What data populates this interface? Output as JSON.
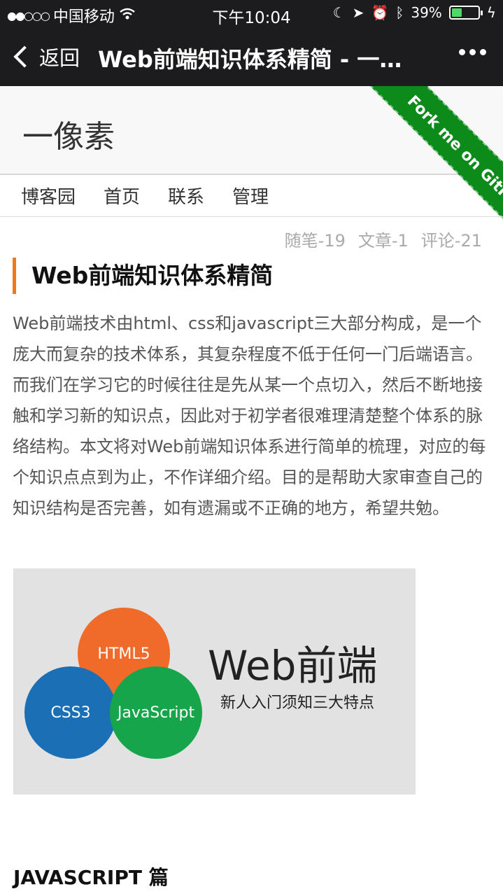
{
  "status_bar": {
    "signal_dots": "●●○○○",
    "carrier": "中国移动",
    "time": "下午10:04",
    "battery_percent": "39%",
    "battery_level": 0.39,
    "icons": [
      "wifi-icon",
      "moon-icon",
      "location-arrow-icon",
      "alarm-icon",
      "bluetooth-icon",
      "battery-icon",
      "charging-icon"
    ]
  },
  "nav": {
    "back_label": "返回",
    "title": "Web前端知识体系精简 - 一…"
  },
  "site": {
    "name": "一像素",
    "nav_items": [
      "博客园",
      "首页",
      "联系",
      "管理"
    ],
    "stats": [
      "随笔-19",
      "文章-1",
      "评论-21"
    ],
    "ribbon_text": "Fork me on GitHub"
  },
  "article": {
    "title": "Web前端知识体系精简",
    "body": "Web前端技术由html、css和javascript三大部分构成，是一个庞大而复杂的技术体系，其复杂程度不低于任何一门后端语言。而我们在学习它的时候往往是先从某一个点切入，然后不断地接触和学习新的知识点，因此对于初学者很难理清楚整个体系的脉络结构。本文将对Web前端知识体系进行简单的梳理，对应的每个知识点点到为止，不作详细介绍。目的是帮助大家审查自己的知识结构是否完善，如有遗漏或不正确的地方，希望共勉。",
    "banner": {
      "circle_html": "HTML5",
      "circle_css": "CSS3",
      "circle_js": "JavaScript",
      "title": "Web前端",
      "subtitle": "新人入门须知三大特点"
    },
    "section_heading": "JAVASCRIPT 篇"
  },
  "colors": {
    "bar_bg": "#1c1c1e",
    "accent_orange": "#f07a1b",
    "ribbon_green": "#0c8a1a",
    "html_orange": "#f06b2a",
    "css_blue": "#1a6fb5",
    "js_green": "#16a54a"
  }
}
